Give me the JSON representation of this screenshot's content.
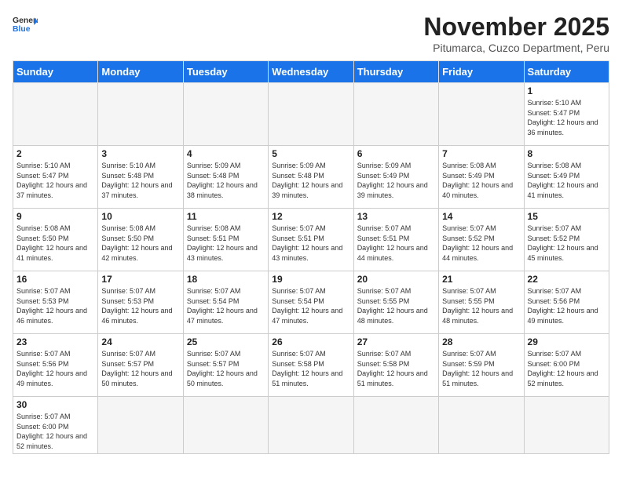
{
  "header": {
    "title": "November 2025",
    "subtitle": "Pitumarca, Cuzco Department, Peru",
    "logo_general": "General",
    "logo_blue": "Blue"
  },
  "days_of_week": [
    "Sunday",
    "Monday",
    "Tuesday",
    "Wednesday",
    "Thursday",
    "Friday",
    "Saturday"
  ],
  "weeks": [
    [
      {
        "day": "",
        "info": ""
      },
      {
        "day": "",
        "info": ""
      },
      {
        "day": "",
        "info": ""
      },
      {
        "day": "",
        "info": ""
      },
      {
        "day": "",
        "info": ""
      },
      {
        "day": "",
        "info": ""
      },
      {
        "day": "1",
        "info": "Sunrise: 5:10 AM\nSunset: 5:47 PM\nDaylight: 12 hours\nand 36 minutes."
      }
    ],
    [
      {
        "day": "2",
        "info": "Sunrise: 5:10 AM\nSunset: 5:47 PM\nDaylight: 12 hours\nand 37 minutes."
      },
      {
        "day": "3",
        "info": "Sunrise: 5:10 AM\nSunset: 5:48 PM\nDaylight: 12 hours\nand 37 minutes."
      },
      {
        "day": "4",
        "info": "Sunrise: 5:09 AM\nSunset: 5:48 PM\nDaylight: 12 hours\nand 38 minutes."
      },
      {
        "day": "5",
        "info": "Sunrise: 5:09 AM\nSunset: 5:48 PM\nDaylight: 12 hours\nand 39 minutes."
      },
      {
        "day": "6",
        "info": "Sunrise: 5:09 AM\nSunset: 5:49 PM\nDaylight: 12 hours\nand 39 minutes."
      },
      {
        "day": "7",
        "info": "Sunrise: 5:08 AM\nSunset: 5:49 PM\nDaylight: 12 hours\nand 40 minutes."
      },
      {
        "day": "8",
        "info": "Sunrise: 5:08 AM\nSunset: 5:49 PM\nDaylight: 12 hours\nand 41 minutes."
      }
    ],
    [
      {
        "day": "9",
        "info": "Sunrise: 5:08 AM\nSunset: 5:50 PM\nDaylight: 12 hours\nand 41 minutes."
      },
      {
        "day": "10",
        "info": "Sunrise: 5:08 AM\nSunset: 5:50 PM\nDaylight: 12 hours\nand 42 minutes."
      },
      {
        "day": "11",
        "info": "Sunrise: 5:08 AM\nSunset: 5:51 PM\nDaylight: 12 hours\nand 43 minutes."
      },
      {
        "day": "12",
        "info": "Sunrise: 5:07 AM\nSunset: 5:51 PM\nDaylight: 12 hours\nand 43 minutes."
      },
      {
        "day": "13",
        "info": "Sunrise: 5:07 AM\nSunset: 5:51 PM\nDaylight: 12 hours\nand 44 minutes."
      },
      {
        "day": "14",
        "info": "Sunrise: 5:07 AM\nSunset: 5:52 PM\nDaylight: 12 hours\nand 44 minutes."
      },
      {
        "day": "15",
        "info": "Sunrise: 5:07 AM\nSunset: 5:52 PM\nDaylight: 12 hours\nand 45 minutes."
      }
    ],
    [
      {
        "day": "16",
        "info": "Sunrise: 5:07 AM\nSunset: 5:53 PM\nDaylight: 12 hours\nand 46 minutes."
      },
      {
        "day": "17",
        "info": "Sunrise: 5:07 AM\nSunset: 5:53 PM\nDaylight: 12 hours\nand 46 minutes."
      },
      {
        "day": "18",
        "info": "Sunrise: 5:07 AM\nSunset: 5:54 PM\nDaylight: 12 hours\nand 47 minutes."
      },
      {
        "day": "19",
        "info": "Sunrise: 5:07 AM\nSunset: 5:54 PM\nDaylight: 12 hours\nand 47 minutes."
      },
      {
        "day": "20",
        "info": "Sunrise: 5:07 AM\nSunset: 5:55 PM\nDaylight: 12 hours\nand 48 minutes."
      },
      {
        "day": "21",
        "info": "Sunrise: 5:07 AM\nSunset: 5:55 PM\nDaylight: 12 hours\nand 48 minutes."
      },
      {
        "day": "22",
        "info": "Sunrise: 5:07 AM\nSunset: 5:56 PM\nDaylight: 12 hours\nand 49 minutes."
      }
    ],
    [
      {
        "day": "23",
        "info": "Sunrise: 5:07 AM\nSunset: 5:56 PM\nDaylight: 12 hours\nand 49 minutes."
      },
      {
        "day": "24",
        "info": "Sunrise: 5:07 AM\nSunset: 5:57 PM\nDaylight: 12 hours\nand 50 minutes."
      },
      {
        "day": "25",
        "info": "Sunrise: 5:07 AM\nSunset: 5:57 PM\nDaylight: 12 hours\nand 50 minutes."
      },
      {
        "day": "26",
        "info": "Sunrise: 5:07 AM\nSunset: 5:58 PM\nDaylight: 12 hours\nand 51 minutes."
      },
      {
        "day": "27",
        "info": "Sunrise: 5:07 AM\nSunset: 5:58 PM\nDaylight: 12 hours\nand 51 minutes."
      },
      {
        "day": "28",
        "info": "Sunrise: 5:07 AM\nSunset: 5:59 PM\nDaylight: 12 hours\nand 51 minutes."
      },
      {
        "day": "29",
        "info": "Sunrise: 5:07 AM\nSunset: 6:00 PM\nDaylight: 12 hours\nand 52 minutes."
      }
    ],
    [
      {
        "day": "30",
        "info": "Sunrise: 5:07 AM\nSunset: 6:00 PM\nDaylight: 12 hours\nand 52 minutes."
      },
      {
        "day": "",
        "info": ""
      },
      {
        "day": "",
        "info": ""
      },
      {
        "day": "",
        "info": ""
      },
      {
        "day": "",
        "info": ""
      },
      {
        "day": "",
        "info": ""
      },
      {
        "day": "",
        "info": ""
      }
    ]
  ]
}
